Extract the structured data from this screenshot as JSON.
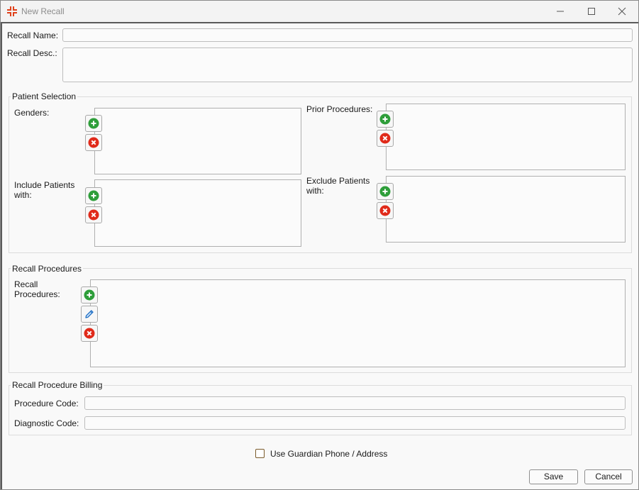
{
  "window": {
    "title": "New Recall"
  },
  "form": {
    "recall_name_label": "Recall Name:",
    "recall_name_value": "",
    "recall_desc_label": "Recall Desc.:",
    "recall_desc_value": ""
  },
  "patient_selection": {
    "title": "Patient Selection",
    "genders_label": "Genders:",
    "prior_procedures_label": "Prior Procedures:",
    "include_label_1": "Include Patients",
    "include_label_2": "with:",
    "exclude_label_1": "Exclude Patients",
    "exclude_label_2": "with:"
  },
  "recall_procedures": {
    "title": "Recall Procedures",
    "label_1": "Recall",
    "label_2": "Procedures:"
  },
  "billing": {
    "title": "Recall Procedure Billing",
    "procedure_code_label": "Procedure Code:",
    "procedure_code_value": "",
    "diagnostic_code_label": "Diagnostic Code:",
    "diagnostic_code_value": ""
  },
  "options": {
    "use_guardian_label": "Use Guardian Phone / Address",
    "use_guardian_checked": false
  },
  "buttons": {
    "save": "Save",
    "cancel": "Cancel"
  },
  "icons": {
    "add": "plus-circle-icon",
    "remove": "x-circle-icon",
    "edit": "pencil-icon",
    "add_color": "#2e9e3a",
    "remove_color": "#e02a1a",
    "edit_color": "#1f6fc5",
    "app_icon_color": "#e0401a"
  }
}
